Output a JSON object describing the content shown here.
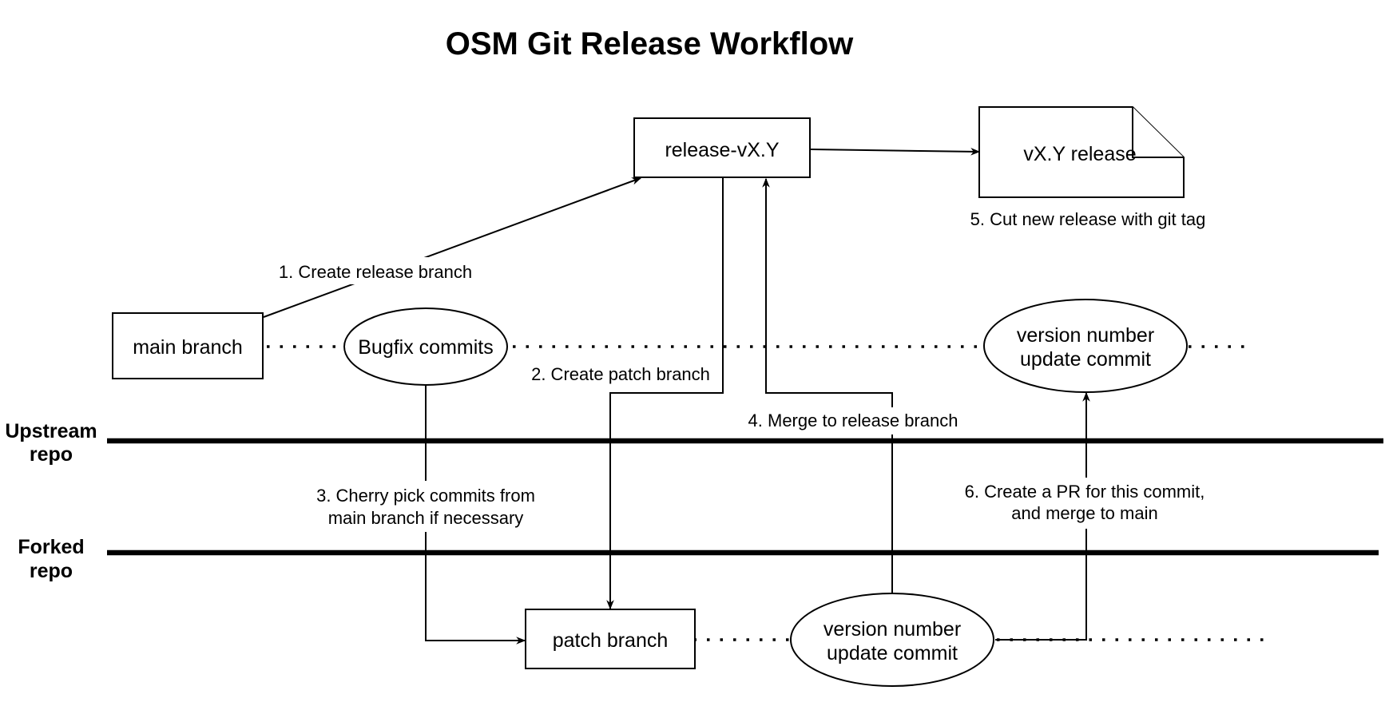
{
  "title": "OSM Git Release Workflow",
  "lanes": {
    "upstream": [
      "Upstream",
      "repo"
    ],
    "forked": [
      "Forked",
      "repo"
    ]
  },
  "nodes": {
    "main_branch": "main branch",
    "bugfix_commits": "Bugfix commits",
    "release_branch": "release-vX.Y",
    "release_doc": "vX.Y release",
    "upstream_version_commit": [
      "version number",
      "update commit"
    ],
    "patch_branch": "patch branch",
    "fork_version_commit": [
      "version number",
      "update commit"
    ]
  },
  "steps": {
    "step1": "1. Create release branch",
    "step2": "2. Create patch branch",
    "step3": [
      "3. Cherry pick commits from",
      "main branch if necessary"
    ],
    "step4": "4. Merge to release branch",
    "step5": "5. Cut new release with git tag",
    "step6": [
      "6. Create a PR for this commit,",
      "and merge to main"
    ]
  }
}
